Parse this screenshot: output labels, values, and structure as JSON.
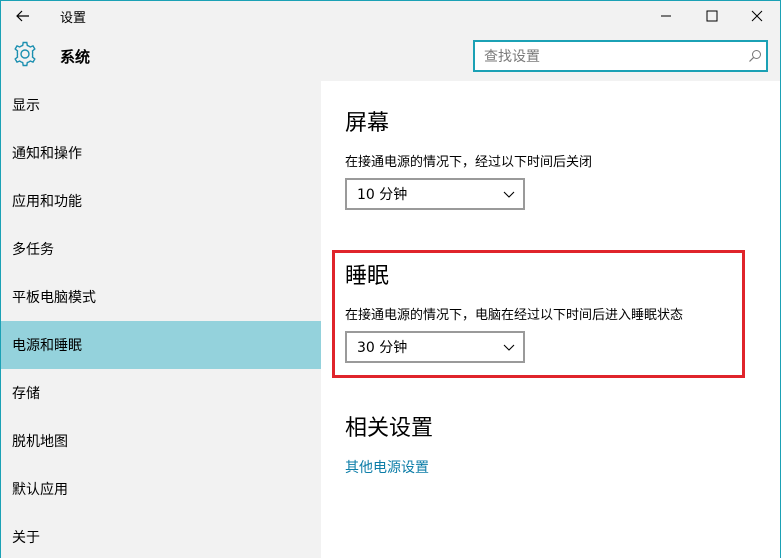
{
  "window": {
    "title": "设置"
  },
  "header": {
    "title": "系统",
    "search_placeholder": "查找设置"
  },
  "sidebar": {
    "items": [
      {
        "label": "显示",
        "active": false
      },
      {
        "label": "通知和操作",
        "active": false
      },
      {
        "label": "应用和功能",
        "active": false
      },
      {
        "label": "多任务",
        "active": false
      },
      {
        "label": "平板电脑模式",
        "active": false
      },
      {
        "label": "电源和睡眠",
        "active": true
      },
      {
        "label": "存储",
        "active": false
      },
      {
        "label": "脱机地图",
        "active": false
      },
      {
        "label": "默认应用",
        "active": false
      },
      {
        "label": "关于",
        "active": false
      }
    ]
  },
  "main": {
    "screen": {
      "title": "屏幕",
      "description": "在接通电源的情况下，经过以下时间后关闭",
      "value": "10 分钟"
    },
    "sleep": {
      "title": "睡眠",
      "description": "在接通电源的情况下，电脑在经过以下时间后进入睡眠状态",
      "value": "30 分钟"
    },
    "related": {
      "title": "相关设置",
      "link": "其他电源设置"
    }
  },
  "colors": {
    "accent": "#1ba1b5",
    "active_nav": "#94d2dc",
    "highlight": "#e0242b",
    "link": "#0c7da8"
  }
}
